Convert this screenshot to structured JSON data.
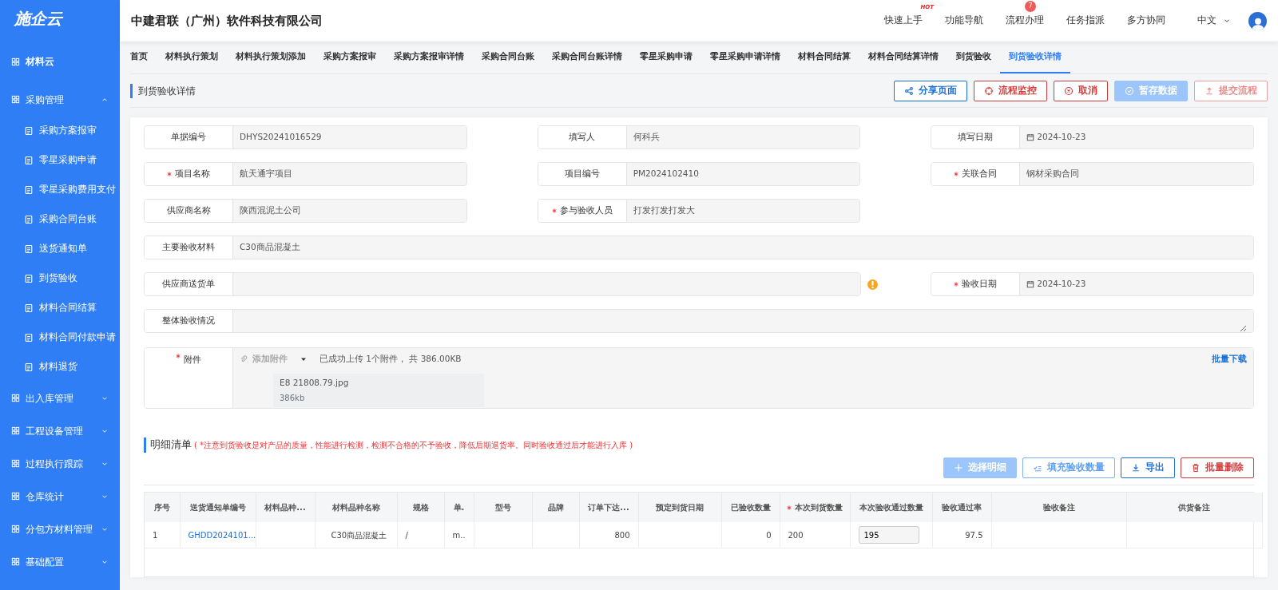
{
  "sidebar": {
    "logo": "施企云",
    "top_item": "材料云",
    "groups": [
      {
        "label": "采购管理",
        "expanded": true,
        "children": [
          "采购方案报审",
          "零星采购申请",
          "零星采购费用支付",
          "采购合同台账",
          "送货通知单",
          "到货验收",
          "材料合同结算",
          "材料合同付款申请",
          "材料退货"
        ]
      },
      {
        "label": "出入库管理",
        "expanded": false
      },
      {
        "label": "工程设备管理",
        "expanded": false
      },
      {
        "label": "过程执行跟踪",
        "expanded": false
      },
      {
        "label": "仓库统计",
        "expanded": false
      },
      {
        "label": "分包方材料管理",
        "expanded": false
      },
      {
        "label": "基础配置",
        "expanded": false
      }
    ]
  },
  "header": {
    "title": "中建君联（广州）软件科技有限公司",
    "nav": [
      {
        "label": "快速上手",
        "hot_tag": "HOT"
      },
      {
        "label": "功能导航"
      },
      {
        "label": "流程办理",
        "badge": "7"
      },
      {
        "label": "任务指派"
      },
      {
        "label": "多方协同"
      }
    ],
    "language": "中文"
  },
  "tabs": [
    {
      "label": "首页",
      "selected": false
    },
    {
      "label": "材料执行策划",
      "selected": false
    },
    {
      "label": "材料执行策划添加",
      "selected": false
    },
    {
      "label": "采购方案报审",
      "selected": false
    },
    {
      "label": "采购方案报审详情",
      "selected": false
    },
    {
      "label": "采购合同台账",
      "selected": false
    },
    {
      "label": "采购合同台账详情",
      "selected": false
    },
    {
      "label": "零星采购申请",
      "selected": false
    },
    {
      "label": "零星采购申请详情",
      "selected": false
    },
    {
      "label": "材料合同结算",
      "selected": false
    },
    {
      "label": "材料合同结算详情",
      "selected": false
    },
    {
      "label": "到货验收",
      "selected": false
    },
    {
      "label": "到货验收详情",
      "selected": true
    }
  ],
  "page_title": "到货验收详情",
  "actions": [
    {
      "label": "分享页面",
      "kind": "share",
      "disabled": false
    },
    {
      "label": "流程监控",
      "kind": "monitor",
      "disabled": false
    },
    {
      "label": "取消",
      "kind": "cancel",
      "disabled": false
    },
    {
      "label": "暂存数据",
      "kind": "save",
      "disabled": true
    },
    {
      "label": "提交流程",
      "kind": "submit",
      "disabled": true
    }
  ],
  "form_rows": [
    [
      {
        "label": "单据编号",
        "kind": "text",
        "required": false,
        "value": "DHYS20241016529"
      },
      {
        "label": "填写人",
        "kind": "text",
        "required": false,
        "value": "何科兵"
      },
      {
        "label": "填写日期",
        "kind": "date",
        "required": false,
        "value": "2024-10-23"
      }
    ],
    [
      {
        "label": "项目名称",
        "kind": "text",
        "required": true,
        "value": "航天通宇项目"
      },
      {
        "label": "项目编号",
        "kind": "text",
        "required": false,
        "value": "PM2024102410"
      },
      {
        "label": "关联合同",
        "kind": "text",
        "required": true,
        "value": "钢材采购合同"
      }
    ],
    [
      {
        "label": "供应商名称",
        "kind": "text",
        "required": false,
        "value": "陕西混泥土公司"
      },
      {
        "label": "参与验收人员",
        "kind": "text",
        "required": true,
        "value": "打发打发打发大"
      }
    ],
    [
      {
        "label": "主要验收材料",
        "kind": "full",
        "required": false,
        "value": "C30商品混凝土"
      }
    ],
    [
      {
        "label": "供应商送货单",
        "kind": "long",
        "required": false,
        "warning": true
      },
      {
        "label": "验收日期",
        "kind": "date",
        "required": true,
        "value": "2024-10-23"
      }
    ],
    [
      {
        "label": "整体验收情况",
        "kind": "textarea",
        "required": false
      }
    ]
  ],
  "attachment": {
    "label": "附件",
    "required": true,
    "add_button": "添加附件",
    "status": "已成功上传 1个附件， 共 386.00KB",
    "batch_download": "批量下载",
    "files": [
      {
        "name": "E8 21808.79.jpg",
        "size": "386kb"
      }
    ]
  },
  "detail": {
    "title": "明细清单",
    "note": "( *注意到货验收是对产品的质量，性能进行检测，检测不合格的不予验收，降低后期退货率。同时验收通过后才能进行入库 )",
    "buttons": [
      {
        "label": "选择明细",
        "kind": "plus",
        "disabled": true
      },
      {
        "label": "填充验收数量",
        "kind": "fill",
        "disabled": true
      },
      {
        "label": "导出",
        "kind": "export",
        "disabled": false
      },
      {
        "label": "批量删除",
        "kind": "delete",
        "disabled": false
      }
    ],
    "columns": [
      {
        "label": "序号",
        "required": false
      },
      {
        "label": "送货通知单编号",
        "required": false
      },
      {
        "label": "材料品种...",
        "required": false
      },
      {
        "label": "材料品种名称",
        "required": false
      },
      {
        "label": "规格",
        "required": false
      },
      {
        "label": "单.",
        "required": false
      },
      {
        "label": "型号",
        "required": false
      },
      {
        "label": "品牌",
        "required": false
      },
      {
        "label": "订单下达...",
        "required": false
      },
      {
        "label": "预定到货日期",
        "required": false
      },
      {
        "label": "已验收数量",
        "required": false
      },
      {
        "label": "本次到货数量",
        "required": true
      },
      {
        "label": "本次验收通过数量",
        "required": false
      },
      {
        "label": "验收通过率",
        "required": false
      },
      {
        "label": "验收备注",
        "required": false
      },
      {
        "label": "供货备注",
        "required": false
      }
    ],
    "rows": [
      {
        "cells": [
          {
            "kind": "text",
            "value": "1"
          },
          {
            "kind": "link",
            "value": "GHDD2024101..."
          },
          {
            "kind": "empty"
          },
          {
            "kind": "text",
            "value": "C30商品混凝土"
          },
          {
            "kind": "text",
            "value": "/"
          },
          {
            "kind": "text",
            "value": "m.."
          },
          {
            "kind": "empty"
          },
          {
            "kind": "empty"
          },
          {
            "kind": "number",
            "value": "800"
          },
          {
            "kind": "empty"
          },
          {
            "kind": "number",
            "value": "0"
          },
          {
            "kind": "text",
            "value": "200"
          },
          {
            "kind": "input",
            "value": "195"
          },
          {
            "kind": "number",
            "value": "97.5"
          },
          {
            "kind": "empty"
          },
          {
            "kind": "empty"
          }
        ]
      }
    ]
  }
}
